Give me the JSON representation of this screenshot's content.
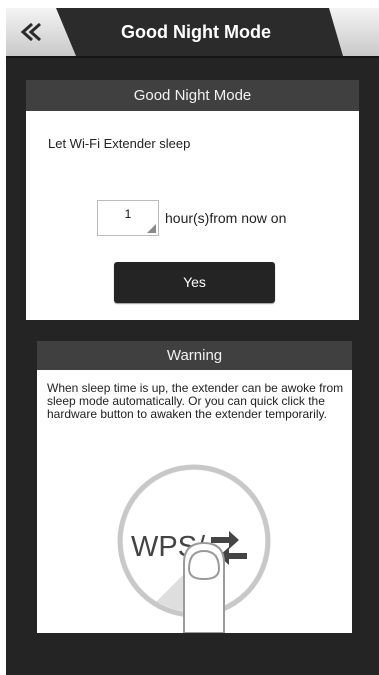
{
  "header": {
    "title": "Good Night Mode",
    "back_icon": "double-chevron-left-icon"
  },
  "sleep_card": {
    "title": "Good Night Mode",
    "label": "Let Wi-Fi Extender sleep",
    "hours_value": "1",
    "hours_unit": "hour(s)from now on",
    "confirm_label": "Yes"
  },
  "warning_card": {
    "title": "Warning",
    "text": "When sleep time is up, the extender can be awoke from sleep mode automatically. Or you can quick click the hardware button to awaken the extender temporarily.",
    "button_label": "WPS/"
  },
  "colors": {
    "background": "#242424",
    "card_header": "#404040",
    "button": "#242424",
    "text": "#222222"
  }
}
